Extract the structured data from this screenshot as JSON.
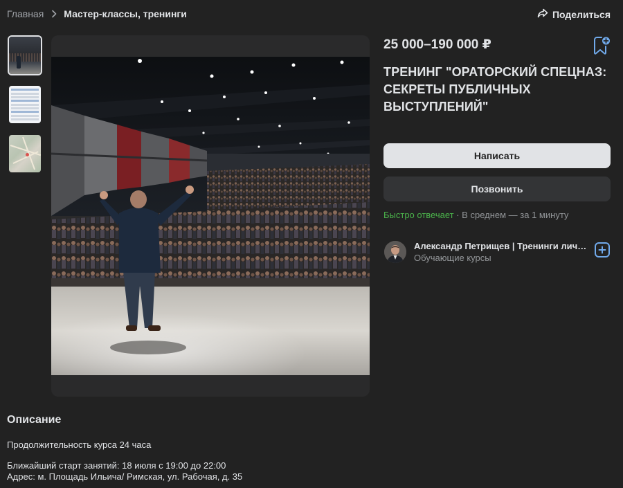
{
  "breadcrumb": {
    "home": "Главная",
    "current": "Мастер-классы, тренинги"
  },
  "share_label": "Поделиться",
  "gallery": {
    "thumbnails": [
      "concert-hall-photo",
      "schedule-table",
      "map"
    ],
    "active_index": 0
  },
  "listing": {
    "price": "25 000–190 000 ₽",
    "title": "ТРЕНИНГ \"ОРАТОРСКИЙ СПЕЦНАЗ: СЕКРЕТЫ ПУБЛИЧНЫХ ВЫСТУПЛЕНИЙ\""
  },
  "actions": {
    "write": "Написать",
    "call": "Позвонить"
  },
  "reply_status": {
    "fast": "Быстро отвечает",
    "average": " · В среднем — за 1 минуту"
  },
  "seller": {
    "name": "Александр Петрищев | Тренинги личностного роста",
    "category": "Обучающие курсы"
  },
  "description": {
    "heading": "Описание",
    "duration": "Продолжительность курса 24 часа",
    "start": "Ближайший старт занятий: 18 июля с 19:00 до 22:00",
    "address": "Адрес: м. Площадь Ильича/ Римская, ул. Рабочая, д. 35"
  },
  "colors": {
    "background": "#222222",
    "text": "#e1e3e6",
    "muted": "#939699",
    "accent_green": "#4bb34b",
    "accent_blue": "#71aaeb"
  }
}
